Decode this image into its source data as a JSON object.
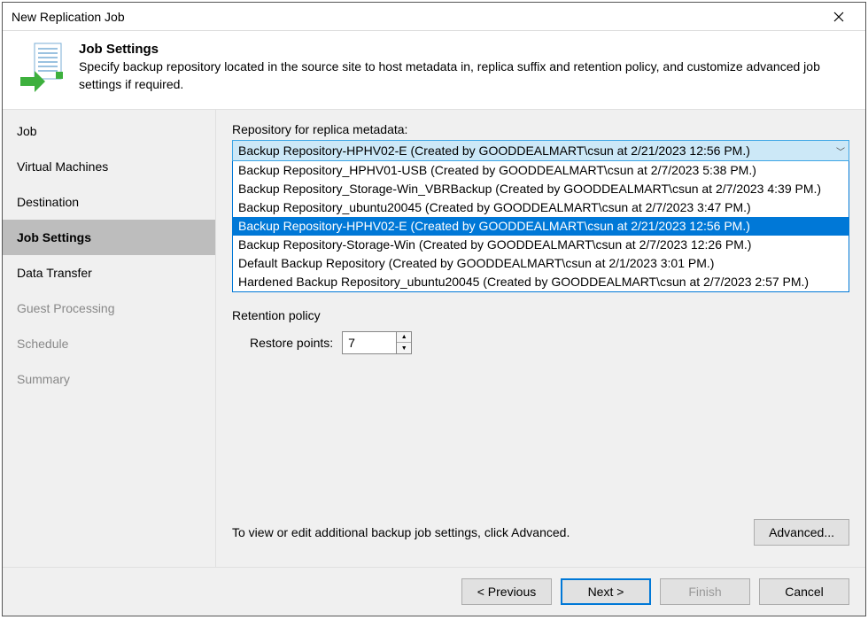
{
  "window": {
    "title": "New Replication Job"
  },
  "header": {
    "title": "Job Settings",
    "description": "Specify backup repository located in the source site to host metadata in, replica suffix and retention policy, and customize advanced job settings if required."
  },
  "sidebar": {
    "items": [
      {
        "label": "Job",
        "active": false,
        "disabled": false
      },
      {
        "label": "Virtual Machines",
        "active": false,
        "disabled": false
      },
      {
        "label": "Destination",
        "active": false,
        "disabled": false
      },
      {
        "label": "Job Settings",
        "active": true,
        "disabled": false
      },
      {
        "label": "Data Transfer",
        "active": false,
        "disabled": false
      },
      {
        "label": "Guest Processing",
        "active": false,
        "disabled": true
      },
      {
        "label": "Schedule",
        "active": false,
        "disabled": true
      },
      {
        "label": "Summary",
        "active": false,
        "disabled": true
      }
    ]
  },
  "content": {
    "repoLabel": "Repository for replica metadata:",
    "repoSelected": "Backup Repository-HPHV02-E (Created by GOODDEALMART\\csun at 2/21/2023 12:56 PM.)",
    "repoOptions": [
      {
        "text": "Backup Repository_HPHV01-USB (Created by GOODDEALMART\\csun at 2/7/2023 5:38 PM.)",
        "selected": false
      },
      {
        "text": "Backup Repository_Storage-Win_VBRBackup (Created by GOODDEALMART\\csun at 2/7/2023 4:39 PM.)",
        "selected": false
      },
      {
        "text": "Backup Repository_ubuntu20045 (Created by GOODDEALMART\\csun at 2/7/2023 3:47 PM.)",
        "selected": false
      },
      {
        "text": "Backup Repository-HPHV02-E (Created by GOODDEALMART\\csun at 2/21/2023 12:56 PM.)",
        "selected": true
      },
      {
        "text": "Backup Repository-Storage-Win (Created by GOODDEALMART\\csun at 2/7/2023 12:26 PM.)",
        "selected": false
      },
      {
        "text": "Default Backup Repository (Created by GOODDEALMART\\csun at 2/1/2023 3:01 PM.)",
        "selected": false
      },
      {
        "text": "Hardened Backup Repository_ubuntu20045 (Created by GOODDEALMART\\csun at 2/7/2023 2:57 PM.)",
        "selected": false
      }
    ],
    "retentionLabel": "Retention policy",
    "restorePointsLabel": "Restore points:",
    "restorePoints": "7",
    "footerAdvText": "To view or edit additional backup job settings, click Advanced.",
    "advancedBtn": "Advanced..."
  },
  "buttons": {
    "previous": "< Previous",
    "next": "Next >",
    "finish": "Finish",
    "cancel": "Cancel"
  }
}
